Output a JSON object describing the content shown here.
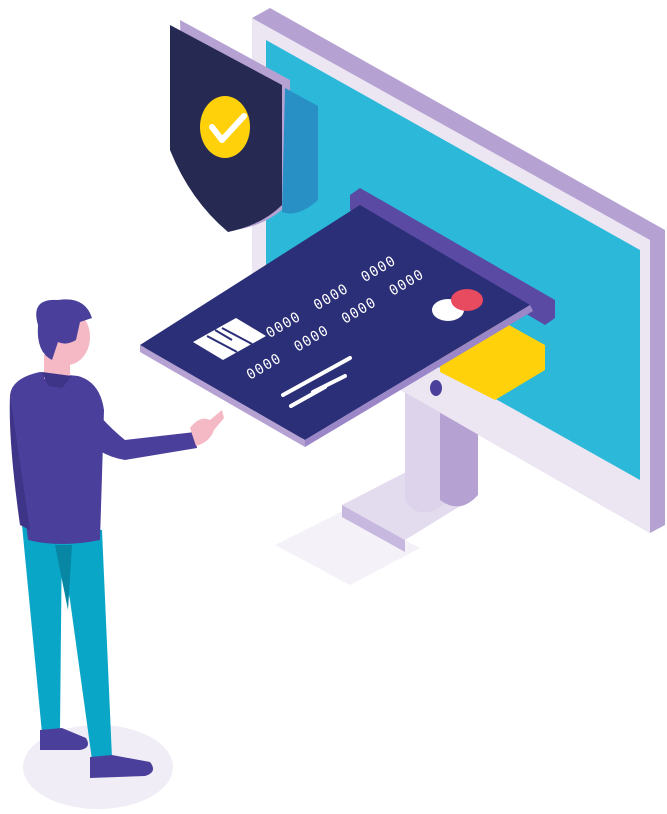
{
  "illustration": {
    "card": {
      "number_groups": [
        "0000",
        "0000",
        "0000",
        "0000"
      ],
      "number_groups_bottom": [
        "0000",
        "0000",
        "0000"
      ]
    },
    "colors": {
      "monitor_frame": "#ece6f3",
      "monitor_bezel": "#b5a1d2",
      "screen": "#2bb8d9",
      "card": "#2b2f78",
      "card_slot": "#5a4aa4",
      "shield": "#262a52",
      "shield_check": "#ffd10a",
      "person_shirt": "#4b3f9c",
      "person_pants": "#0aa6c8",
      "accent_red": "#e84a5f",
      "accent_yellow": "#ffd10a"
    },
    "icons": [
      "shield-check-icon",
      "card-chip-icon",
      "mastercard-logo-icon"
    ]
  }
}
